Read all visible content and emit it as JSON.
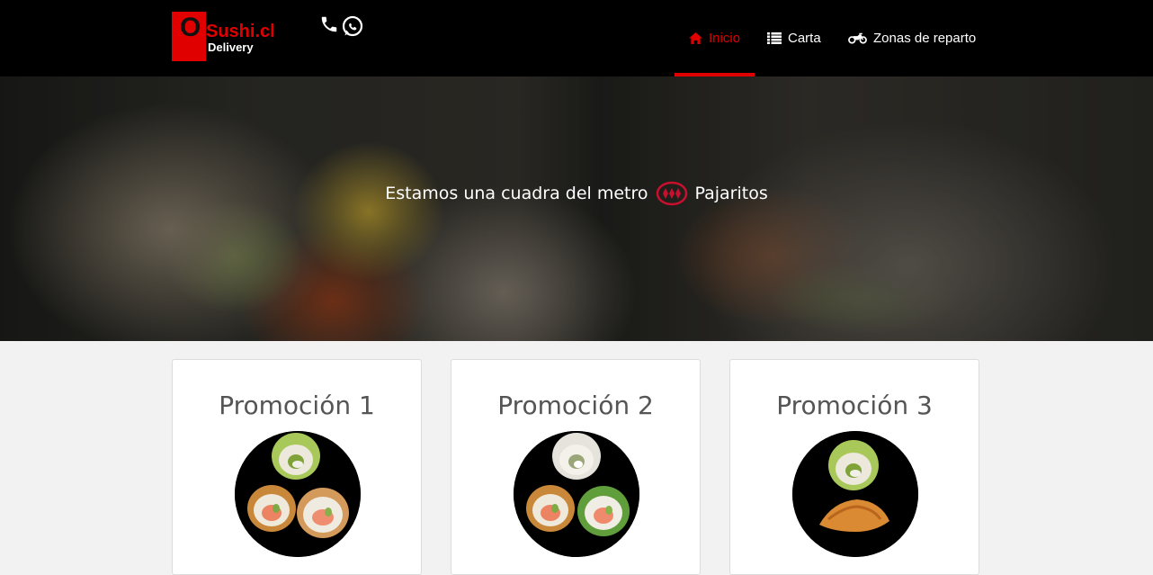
{
  "brand": {
    "logo_letter": "O",
    "name": "Sushi.cl",
    "tagline": "Delivery"
  },
  "contact_icons": [
    "phone-icon",
    "whatsapp-icon"
  ],
  "nav": [
    {
      "label": "Inicio",
      "icon": "home-icon",
      "active": true
    },
    {
      "label": "Carta",
      "icon": "list-icon",
      "active": false
    },
    {
      "label": "Zonas de reparto",
      "icon": "motorcycle-icon",
      "active": false
    }
  ],
  "hero": {
    "text_before": "Estamos una cuadra del metro",
    "text_after": "Pajaritos",
    "icon": "metro-icon"
  },
  "promotions": [
    {
      "title": "Promoción 1",
      "image": "promo-1-sushi-image"
    },
    {
      "title": "Promoción 2",
      "image": "promo-2-sushi-image"
    },
    {
      "title": "Promoción 3",
      "image": "promo-3-sushi-gyoza-image"
    }
  ],
  "colors": {
    "accent": "#e10000",
    "navbar": "#000000",
    "page_bg": "#f2f2f2",
    "card_title": "#555555"
  }
}
